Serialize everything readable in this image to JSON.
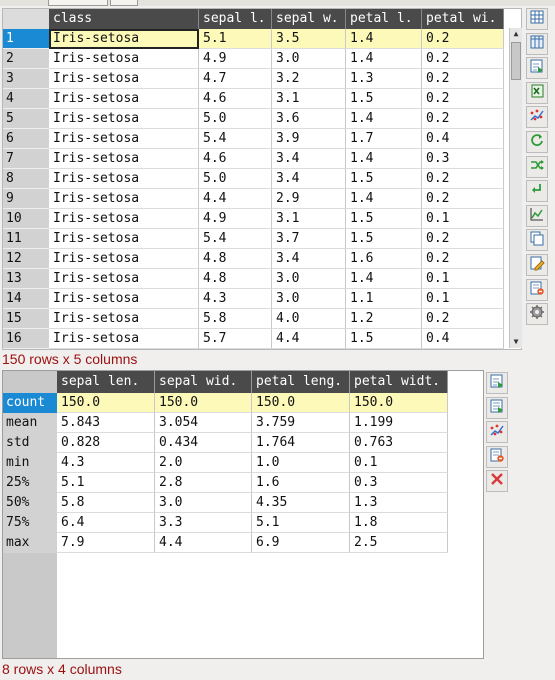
{
  "data_table": {
    "columns": [
      "class",
      "sepal l.",
      "sepal w.",
      "petal l.",
      "petal wi."
    ],
    "rows": [
      {
        "n": "1",
        "cells": [
          "Iris-setosa",
          "5.1",
          "3.5",
          "1.4",
          "0.2"
        ]
      },
      {
        "n": "2",
        "cells": [
          "Iris-setosa",
          "4.9",
          "3.0",
          "1.4",
          "0.2"
        ]
      },
      {
        "n": "3",
        "cells": [
          "Iris-setosa",
          "4.7",
          "3.2",
          "1.3",
          "0.2"
        ]
      },
      {
        "n": "4",
        "cells": [
          "Iris-setosa",
          "4.6",
          "3.1",
          "1.5",
          "0.2"
        ]
      },
      {
        "n": "5",
        "cells": [
          "Iris-setosa",
          "5.0",
          "3.6",
          "1.4",
          "0.2"
        ]
      },
      {
        "n": "6",
        "cells": [
          "Iris-setosa",
          "5.4",
          "3.9",
          "1.7",
          "0.4"
        ]
      },
      {
        "n": "7",
        "cells": [
          "Iris-setosa",
          "4.6",
          "3.4",
          "1.4",
          "0.3"
        ]
      },
      {
        "n": "8",
        "cells": [
          "Iris-setosa",
          "5.0",
          "3.4",
          "1.5",
          "0.2"
        ]
      },
      {
        "n": "9",
        "cells": [
          "Iris-setosa",
          "4.4",
          "2.9",
          "1.4",
          "0.2"
        ]
      },
      {
        "n": "10",
        "cells": [
          "Iris-setosa",
          "4.9",
          "3.1",
          "1.5",
          "0.1"
        ]
      },
      {
        "n": "11",
        "cells": [
          "Iris-setosa",
          "5.4",
          "3.7",
          "1.5",
          "0.2"
        ]
      },
      {
        "n": "12",
        "cells": [
          "Iris-setosa",
          "4.8",
          "3.4",
          "1.6",
          "0.2"
        ]
      },
      {
        "n": "13",
        "cells": [
          "Iris-setosa",
          "4.8",
          "3.0",
          "1.4",
          "0.1"
        ]
      },
      {
        "n": "14",
        "cells": [
          "Iris-setosa",
          "4.3",
          "3.0",
          "1.1",
          "0.1"
        ]
      },
      {
        "n": "15",
        "cells": [
          "Iris-setosa",
          "5.8",
          "4.0",
          "1.2",
          "0.2"
        ]
      },
      {
        "n": "16",
        "cells": [
          "Iris-setosa",
          "5.7",
          "4.4",
          "1.5",
          "0.4"
        ]
      }
    ],
    "status": "150 rows x 5 columns"
  },
  "stats_table": {
    "columns": [
      "sepal len.",
      "sepal wid.",
      "petal leng.",
      "petal widt."
    ],
    "rows": [
      {
        "n": "count",
        "cells": [
          "150.0",
          "150.0",
          "150.0",
          "150.0"
        ]
      },
      {
        "n": "mean",
        "cells": [
          "5.843",
          "3.054",
          "3.759",
          "1.199"
        ]
      },
      {
        "n": "std",
        "cells": [
          "0.828",
          "0.434",
          "1.764",
          "0.763"
        ]
      },
      {
        "n": "min",
        "cells": [
          "4.3",
          "2.0",
          "1.0",
          "0.1"
        ]
      },
      {
        "n": "25%",
        "cells": [
          "5.1",
          "2.8",
          "1.6",
          "0.3"
        ]
      },
      {
        "n": "50%",
        "cells": [
          "5.8",
          "3.0",
          "4.35",
          "1.3"
        ]
      },
      {
        "n": "75%",
        "cells": [
          "6.4",
          "3.3",
          "5.1",
          "1.8"
        ]
      },
      {
        "n": "max",
        "cells": [
          "7.9",
          "4.4",
          "6.9",
          "2.5"
        ]
      }
    ],
    "status": "8 rows x 4 columns"
  },
  "toolbar_top": [
    "table-grid-icon",
    "table-columns-icon",
    "export-table-icon",
    "excel-icon",
    "scatter-plot-icon",
    "refresh-icon",
    "shuffle-icon",
    "undo-icon",
    "line-chart-icon",
    "copy-pages-icon",
    "edit-document-icon",
    "document-remove-icon",
    "settings-gear-icon"
  ],
  "toolbar_bottom": [
    "export-table-icon",
    "export-sheet-icon",
    "scatter-plot-icon",
    "document-remove-icon",
    "close-icon"
  ],
  "colors": {
    "selection": "#1a8ad4",
    "highlight_row": "#fdf9b8",
    "header": "#4a4a4a",
    "status_text": "#9b0f0f",
    "close_red": "#d63b3b"
  }
}
